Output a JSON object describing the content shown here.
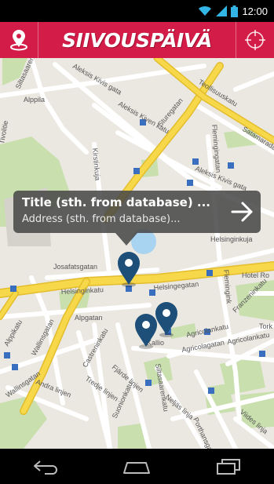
{
  "status_bar": {
    "time": "12:00"
  },
  "header": {
    "logo_text": "SIIVOUSPÄIVÄ"
  },
  "map": {
    "streets": {
      "siltasaarenkatu": "Siltasaarenkatu",
      "alppila": "Alppila",
      "aleksis_kivis_gata": "Aleksis Kivis gata",
      "aleksis_kiven_katu": "Aleksis Kiven katu",
      "sturegatan": "Sturegatan",
      "teollisuuskatu": "Teollisuuskatu",
      "satamaradank": "Satamaradank",
      "flemingingatan": "Flemingingatan",
      "aleksis_kivis_gata_2": "Aleksis Kivis gata",
      "tivolitie": "Tivolitie",
      "kirstinkuja": "Kirstinkuja",
      "helsinginkuja": "Helsinginkuja",
      "josafatsgatan": "Josafatsgatan",
      "helsinginkatu": "Helsinginkatu",
      "helsingegatan": "Helsingegatan",
      "hotel": "Hotel Ro",
      "alpgatan": "Alpgatan",
      "franzeninkatu": "Franzeninkatu",
      "torkk": "Tork",
      "alppikatu": "Alppikatu",
      "wallinsgatan": "Wallinsgatan",
      "castreninkatu": "Castreninkatu",
      "fjarde_linjen": "Fjärde linjen",
      "agricolankatu": "Agricolankatu",
      "agricolagatan": "Agricolagatan",
      "agricolankatu_2": "Agricolankatu",
      "kallio": "Kallio",
      "andra_linjen": "Andra linjen",
      "tredje_linjen": "Tredje linjen",
      "suonionkatu": "Suonionkatu",
      "sitasaarenkatu_2": "Siltasaarenkatu",
      "neljas_linja": "Neljäs linja",
      "porthansgatan": "Porthansgatan",
      "viides_linja": "Viides linja",
      "wallinsgatan_2": "Wallinsgatan",
      "flemingink": "Flemingink"
    }
  },
  "callout": {
    "title": "Title (sth. from database) ...",
    "address": "Address (sth. from database)..."
  },
  "colors": {
    "header": "#d31c47",
    "pin": "#1d4f78",
    "major_road": "#f7d84a",
    "park": "#c9dfae"
  }
}
